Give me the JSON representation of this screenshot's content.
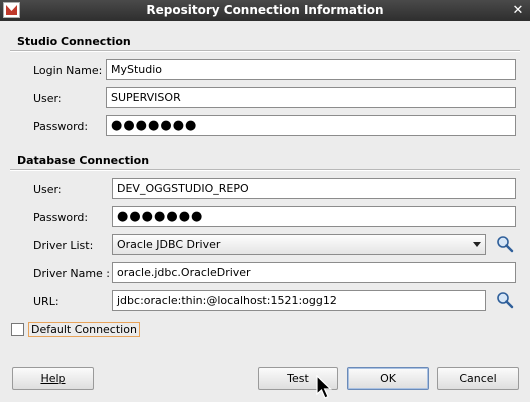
{
  "window": {
    "title": "Repository Connection Information",
    "close_glyph": "✕"
  },
  "studio_connection": {
    "heading": "Studio Connection",
    "login_name_label": "Login Name:",
    "login_name_value": "MyStudio",
    "user_label": "User:",
    "user_value": "SUPERVISOR",
    "password_label": "Password:",
    "password_value": "●●●●●●●"
  },
  "database_connection": {
    "heading": "Database Connection",
    "user_label": "User:",
    "user_value": "DEV_OGGSTUDIO_REPO",
    "password_label": "Password:",
    "password_value": "●●●●●●●",
    "driver_list_label": "Driver List:",
    "driver_list_selected": "Oracle JDBC Driver",
    "driver_name_label": "Driver Name :",
    "driver_name_value": "oracle.jdbc.OracleDriver",
    "url_label": "URL:",
    "url_value": "jdbc:oracle:thin:@localhost:1521:ogg12"
  },
  "default_connection": {
    "label": "Default Connection",
    "checked": false
  },
  "buttons": {
    "help": "Help",
    "test": "Test",
    "ok": "OK",
    "cancel": "Cancel"
  },
  "icons": {
    "search": "magnifier-icon"
  },
  "colors": {
    "titlebar": "#2e2e2e",
    "focus_border": "#e8a35a",
    "default_button_border": "#6a8ab8"
  }
}
